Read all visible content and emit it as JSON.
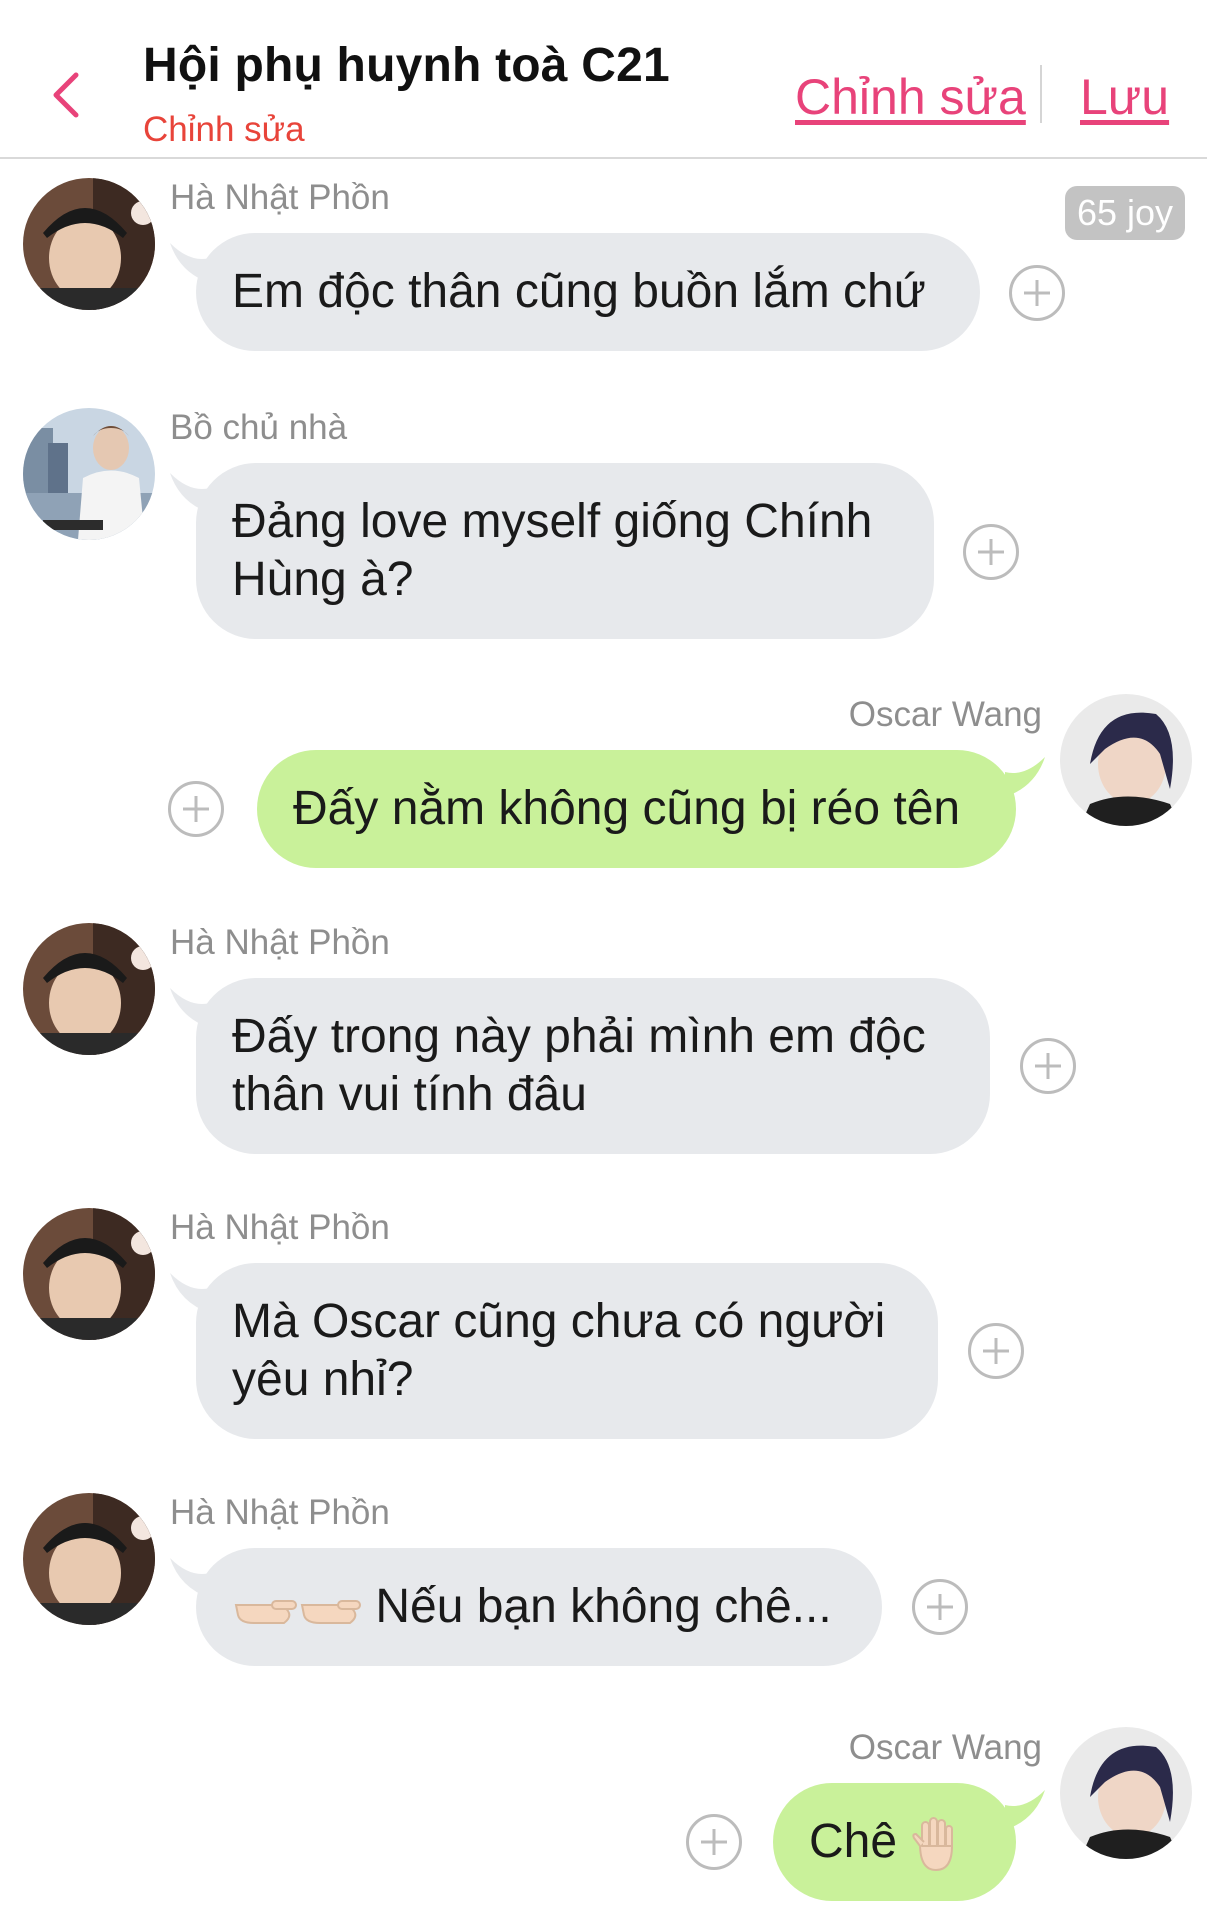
{
  "header": {
    "title": "Hội phụ huynh toà C21",
    "subtitle": "Chỉnh sửa",
    "edit_label": "Chỉnh sửa",
    "save_label": "Lưu"
  },
  "colors": {
    "accent": "#e8437a",
    "subtitle": "#e8443a",
    "bubble_other": "#e7e9ec",
    "bubble_self": "#c9f19a",
    "name_gray": "#8e8e8e"
  },
  "messages": [
    {
      "sender": "Hà Nhật Phồn",
      "text": "Em độc thân cũng buồn lắm chứ",
      "side": "left",
      "badge": "65 joy"
    },
    {
      "sender": "Bồ chủ nhà",
      "line1": "Đảng love myself giống Chính",
      "line2": "Hùng à?",
      "side": "left"
    },
    {
      "sender": "Oscar Wang",
      "text": "Đấy nằm không cũng bị réo tên",
      "side": "right"
    },
    {
      "sender": "Hà Nhật Phồn",
      "line1": "Đấy trong này phải mình em độc",
      "line2": "thân vui tính đâu",
      "side": "left"
    },
    {
      "sender": "Hà Nhật Phồn",
      "line1": "Mà Oscar cũng chưa có người",
      "line2": "yêu nhỉ?",
      "side": "left"
    },
    {
      "sender": "Hà Nhật Phồn",
      "text": "Nếu bạn không chê...",
      "emoji": "pointing-hands-icon",
      "side": "left"
    },
    {
      "sender": "Oscar Wang",
      "text": "Chê",
      "emoji": "raised-hand-icon",
      "side": "right"
    }
  ]
}
